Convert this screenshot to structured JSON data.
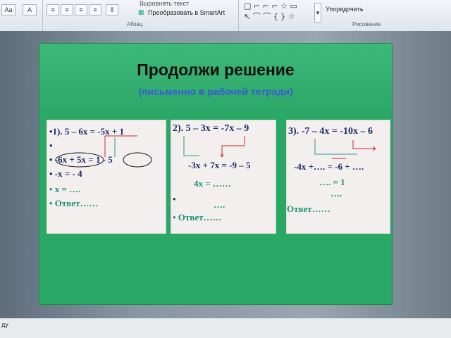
{
  "ribbon": {
    "font_buttons": [
      "Aa",
      "A"
    ],
    "text_direction": "Выровнять текст",
    "smartart": "Преобразовать в SmartArt",
    "paragraph_label": "Абзац",
    "arrange": "Упорядочить",
    "drawing_label": "Рисование",
    "shapes_row1": "□ ⌐ ⌐ ⌐ ☆ ▭",
    "shapes_row2": "↖ ⌒ ⌒ { } ☆"
  },
  "slide": {
    "title": "Продолжи решение",
    "subtitle": "(письменно в рабочей тетради)"
  },
  "cards": [
    {
      "lines": [
        {
          "text": "•1). 5 – 6x =  -5x + 1"
        },
        {
          "text": "•"
        },
        {
          "text": "• -6x + 5x = 1 - 5"
        },
        {
          "text": "•        -x = - 4"
        },
        {
          "text": "•              x = …."
        },
        {
          "text": "•  Ответ……"
        }
      ]
    },
    {
      "lines": [
        {
          "text": "2). 5 – 3x =  -7x – 9"
        },
        {
          "text": "-3x + 7x = -9 – 5"
        },
        {
          "text": "4x = ……"
        },
        {
          "text": "•"
        },
        {
          "text": "…."
        },
        {
          "text": "•  Ответ……"
        }
      ]
    },
    {
      "lines": [
        {
          "text": "3). -7 – 4x = -10x – 6"
        },
        {
          "text": "-4x +…. = -6 + …."
        },
        {
          "text": "…. = 1"
        },
        {
          "text": "…."
        },
        {
          "text": "Ответ……"
        }
      ]
    }
  ],
  "status": {
    "text": "ду"
  },
  "colors": {
    "slide_bg": "#2aa866",
    "subtitle": "#3a5bd6",
    "navy": "#1c2a6b",
    "green": "#1e8f7a",
    "red": "#cc2a2a"
  }
}
